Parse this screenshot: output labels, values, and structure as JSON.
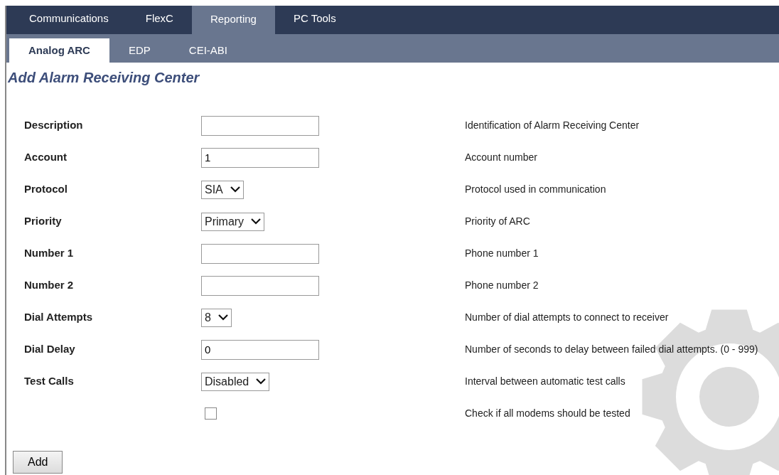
{
  "main_tabs": [
    {
      "label": "Communications",
      "selected": false
    },
    {
      "label": "FlexC",
      "selected": false
    },
    {
      "label": "Reporting",
      "selected": true
    },
    {
      "label": "PC Tools",
      "selected": false
    }
  ],
  "sub_tabs": [
    {
      "label": "Analog ARC",
      "selected": true
    },
    {
      "label": "EDP",
      "selected": false
    },
    {
      "label": "CEI-ABI",
      "selected": false
    }
  ],
  "page_title": "Add Alarm Receiving Center",
  "fields": [
    {
      "label": "Description",
      "kind": "text",
      "help": "Identification of Alarm Receiving Center"
    },
    {
      "label": "Account",
      "kind": "text",
      "value": "1",
      "help": "Account number"
    },
    {
      "label": "Protocol",
      "kind": "select",
      "value": "SIA",
      "help": "Protocol used in communication"
    },
    {
      "label": "Priority",
      "kind": "select",
      "value": "Primary",
      "help": "Priority of ARC"
    },
    {
      "label": "Number 1",
      "kind": "text",
      "help": "Phone number 1"
    },
    {
      "label": "Number 2",
      "kind": "text",
      "help": "Phone number 2"
    },
    {
      "label": "Dial Attempts",
      "kind": "select",
      "value": "8",
      "help": "Number of dial attempts to connect to receiver"
    },
    {
      "label": "Dial Delay",
      "kind": "text",
      "value": "0",
      "help": "Number of seconds to delay between failed dial attempts. (0 - 999)"
    },
    {
      "label": "Test Calls",
      "kind": "select",
      "value": "Disabled",
      "help": "Interval between automatic test calls"
    },
    {
      "kind": "checkbox",
      "checked": false,
      "help": "Check if all modems should be tested"
    }
  ],
  "add_button": "Add"
}
